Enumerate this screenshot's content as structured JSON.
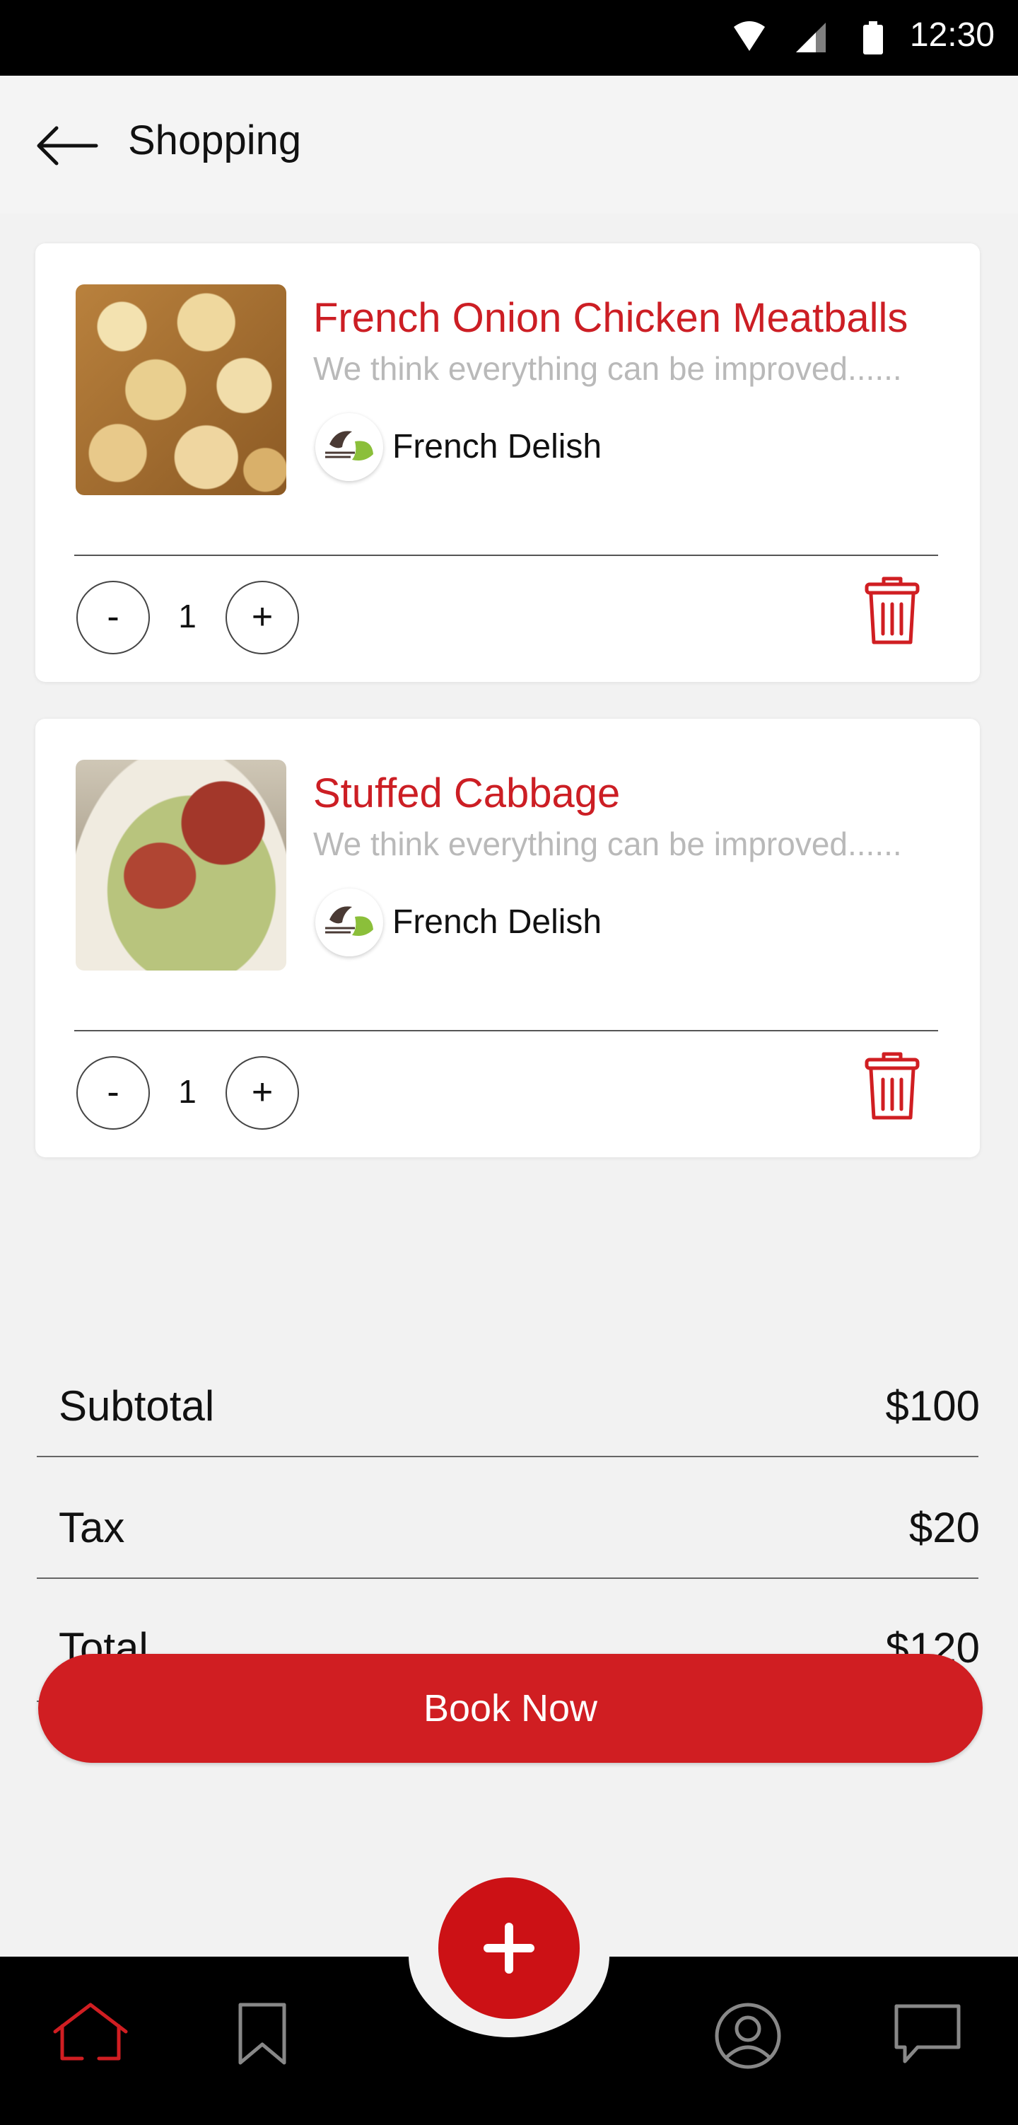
{
  "status_bar": {
    "time": "12:30",
    "icons": [
      "wifi-icon",
      "cellular-signal-icon",
      "battery-icon"
    ]
  },
  "header": {
    "back_icon": "arrow-left-icon",
    "title": "Shopping"
  },
  "cart": {
    "items": [
      {
        "title": "French Onion Chicken Meatballs",
        "description": "We think everything can be improved......",
        "vendor": "French Delish",
        "quantity": "1",
        "minus_label": "-",
        "plus_label": "+",
        "image": "meatballs-photo"
      },
      {
        "title": "Stuffed Cabbage",
        "description": "We think everything can be improved......",
        "vendor": "French Delish",
        "quantity": "1",
        "minus_label": "-",
        "plus_label": "+",
        "image": "stuffed-cabbage-photo"
      }
    ]
  },
  "summary": {
    "subtotal_label": "Subtotal",
    "subtotal_value": "$100",
    "tax_label": "Tax",
    "tax_value": "$20",
    "total_label": "Total",
    "total_value": "$120"
  },
  "book_button": {
    "label": "Book Now"
  },
  "bottom_nav": {
    "items": [
      "home-icon",
      "bookmark-icon",
      "profile-icon",
      "chat-icon"
    ],
    "active": "home-icon",
    "fab_icon": "plus-icon"
  },
  "colors": {
    "accent": "#d01e22",
    "title_red": "#cc1e24",
    "muted_text": "#b9b9b9",
    "nav_bg": "#000000"
  }
}
